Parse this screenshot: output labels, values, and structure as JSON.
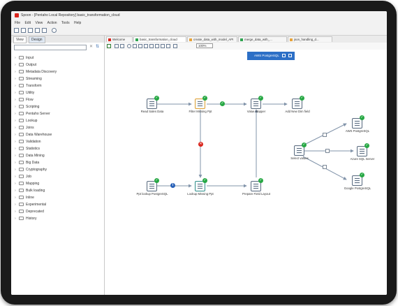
{
  "window": {
    "title": "Spoon - [Pentaho Local Repository] basic_transformation_cloud"
  },
  "menu": [
    "File",
    "Edit",
    "View",
    "Action",
    "Tools",
    "Help"
  ],
  "left_panel": {
    "tabs": [
      "View",
      "Design"
    ],
    "search_value": "",
    "clear_icon": "✕",
    "expand_icon": "⇅",
    "tree": [
      "Input",
      "Output",
      "Metadata Discovery",
      "Streaming",
      "Transform",
      "Utility",
      "Flow",
      "Scripting",
      "Pentaho Server",
      "Lookup",
      "Joins",
      "Data Warehouse",
      "Validation",
      "Statistics",
      "Data Mining",
      "Big Data",
      "Cryptography",
      "Job",
      "Mapping",
      "Bulk loading",
      "Inline",
      "Experimental",
      "Deprecated",
      "History"
    ]
  },
  "editor_tabs": [
    {
      "label": "Welcome",
      "color": "#d9251c"
    },
    {
      "label": "basic_transformation_cloud",
      "color": "#2ea44f"
    },
    {
      "label": "create_data_with_model_API",
      "color": "#e8a33a"
    },
    {
      "label": "merge_data_with_...",
      "color": "#2ea44f"
    },
    {
      "label": "json_handling_d...",
      "color": "#e8a33a"
    }
  ],
  "zoom": "100%",
  "run_target": {
    "label": "AWS PostgreSQL"
  },
  "steps": {
    "read_sales_data": "Read Sales Data",
    "filter_missing_ppt": "Filter Missing Ppt",
    "value_mapper": "Value Mapper",
    "add_new_dim_field": "Add New Dim field",
    "ppt_lookup": "Ppt lookup PostgreSQL",
    "lookup_missing": "Lookup Missing Ppt",
    "prepare_field_layout": "Prepare Field Layout",
    "select_values": "Select values",
    "aws_postgresql": "AWS PostgreSQL",
    "azure_sql_server": "Azure SQL Server",
    "google_postgresql": "Google PostgreSQL"
  },
  "icons": {
    "check": "✓",
    "error": "✕",
    "info": "i"
  }
}
